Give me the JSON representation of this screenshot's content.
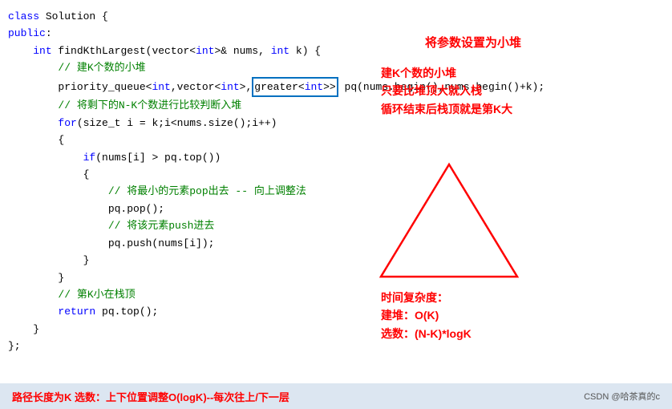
{
  "code": {
    "lines": [
      {
        "type": "class_decl",
        "text": "class Solution {"
      },
      {
        "type": "access",
        "text": "public:"
      },
      {
        "type": "func_sig",
        "text": "    int findKthLargest(vector<int>& nums, int k) {"
      },
      {
        "type": "comment",
        "text": "        // 建K个数的小堆"
      },
      {
        "type": "pq_decl",
        "text": "        priority_queue<int,vector<int>,"
      },
      {
        "type": "pq_decl2",
        "text": "greater<int>> pq(nums.begin(),nums.begin()+k);"
      },
      {
        "type": "comment",
        "text": "        // 将剩下的N-K个数进行比较判断入堆"
      },
      {
        "type": "for",
        "text": "        for(size_t i = k;i<nums.size();i++)"
      },
      {
        "type": "brace",
        "text": "        {"
      },
      {
        "type": "if",
        "text": "            if(nums[i] > pq.top())"
      },
      {
        "type": "brace",
        "text": "            {"
      },
      {
        "type": "comment",
        "text": "                // 将最小的元素pop出去 -- 向上调整法"
      },
      {
        "type": "pop",
        "text": "                pq.pop();"
      },
      {
        "type": "comment",
        "text": "                // 将该元素push进去"
      },
      {
        "type": "push",
        "text": "                pq.push(nums[i]);"
      },
      {
        "type": "brace",
        "text": "            }"
      },
      {
        "type": "brace",
        "text": "        }"
      },
      {
        "type": "comment",
        "text": "        // 第K小在栈顶"
      },
      {
        "type": "return",
        "text": "        return pq.top();"
      },
      {
        "type": "brace",
        "text": "    }"
      },
      {
        "type": "brace",
        "text": "};"
      }
    ]
  },
  "annotations": {
    "param_label": "将参数设置为小堆",
    "heap_title": "建K个数的小堆",
    "heap_line2": "只要比堆顶大就入栈",
    "heap_line3": "循环结束后栈顶就是第K大",
    "complexity_title": "时间复杂度：",
    "complexity_build": "建堆：O(K)",
    "complexity_select": "选数：(N-K)*logK"
  },
  "bottom": {
    "text": "路径长度为K  选数：上下位置调整O(logK)--每次往上/下一层",
    "credit": "CSDN @哈茶真的c"
  }
}
